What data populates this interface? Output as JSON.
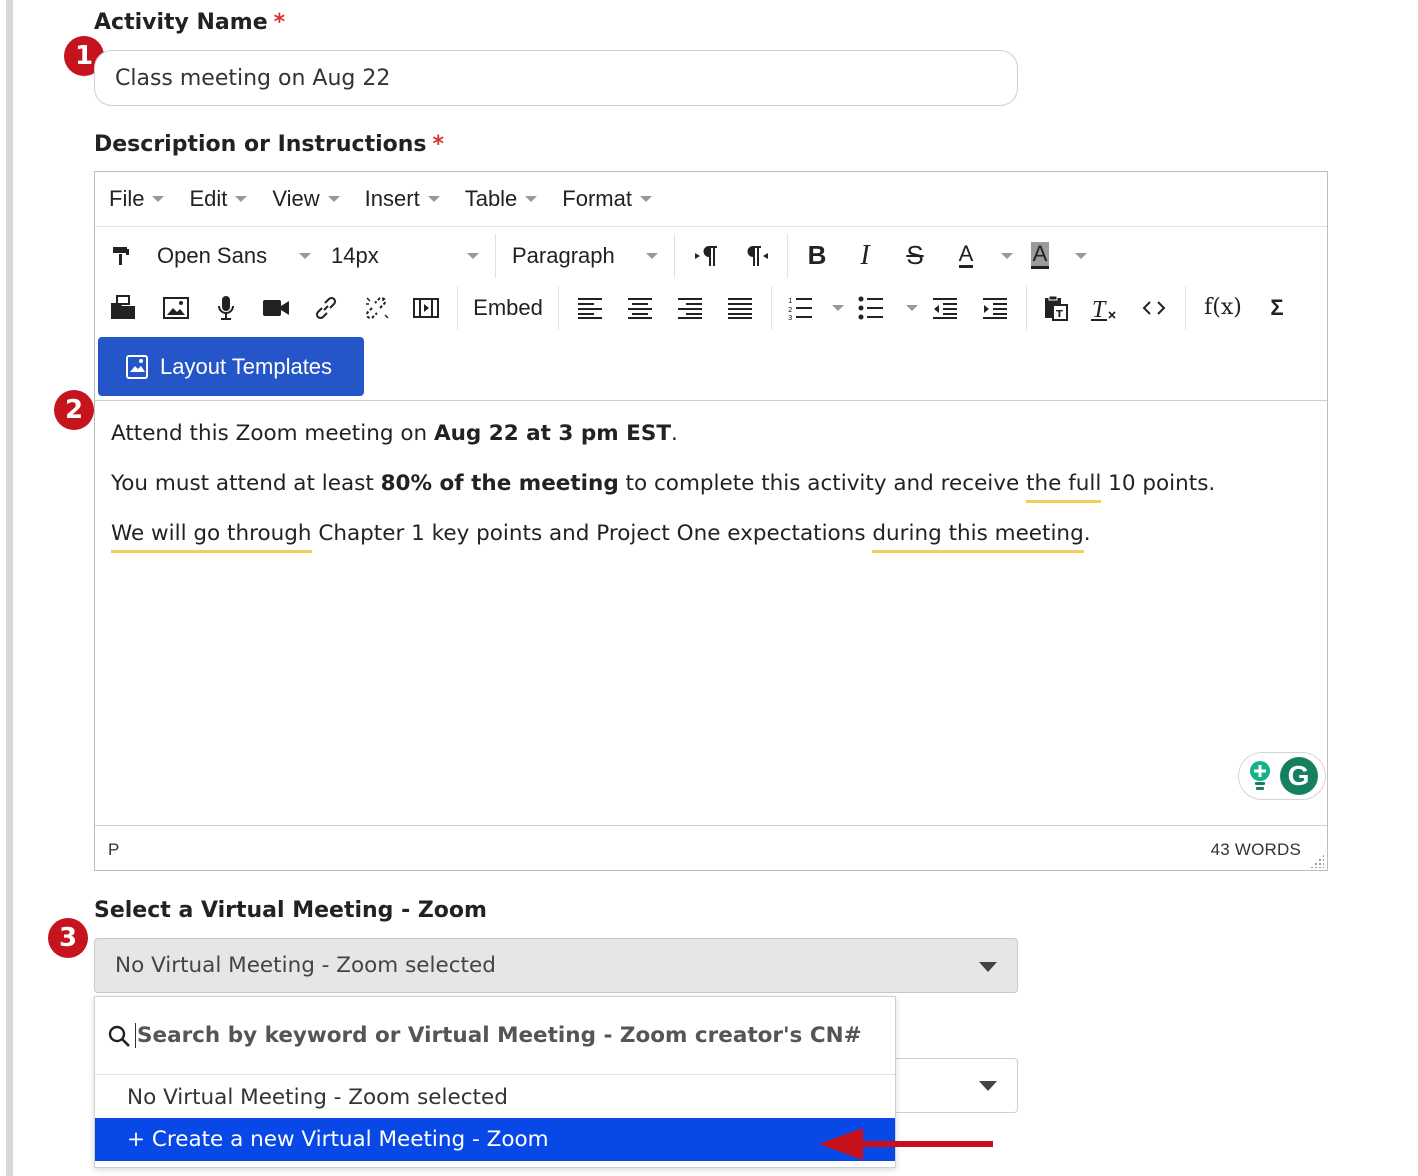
{
  "activity": {
    "label": "Activity Name",
    "required_mark": "*",
    "value": "Class meeting on Aug 22"
  },
  "steps": [
    "1",
    "2",
    "3"
  ],
  "description": {
    "label": "Description or Instructions",
    "required_mark": "*"
  },
  "editor": {
    "menus": [
      "File",
      "Edit",
      "View",
      "Insert",
      "Table",
      "Format"
    ],
    "font_family": "Open Sans",
    "font_size": "14px",
    "block_format": "Paragraph",
    "embed_label": "Embed",
    "fx_label": "f(x)",
    "sigma_label": "Σ",
    "layout_templates_label": "Layout Templates",
    "content": {
      "p1_a": "Attend this Zoom meeting on ",
      "p1_b": "Aug 22 at 3 pm EST",
      "p1_c": ".",
      "p2_a": "You must attend at least ",
      "p2_b": "80% of the meeting",
      "p2_c": " to complete this activity and receive ",
      "p2_d": "the full",
      "p2_e": " 10 points.",
      "p3_a": "We will go through",
      "p3_b": " Chapter 1 key points and Project One expectations ",
      "p3_c": "during this meeting",
      "p3_d": "."
    },
    "status_path": "P",
    "word_count": "43 WORDS",
    "grammarly_letter": "G"
  },
  "zoom": {
    "label": "Select a Virtual Meeting - Zoom",
    "selected": "No Virtual Meeting - Zoom selected",
    "search_placeholder": "Search by keyword or Virtual Meeting - Zoom creator's CN#",
    "options": [
      "No Virtual Meeting - Zoom selected",
      "+ Create a new Virtual Meeting - Zoom"
    ]
  },
  "colors": {
    "badge": "#c5141d",
    "primary_button": "#2456c9",
    "highlight": "#0748e6",
    "annotation_arrow": "#c8101c",
    "grammar_underline": "#f5cd5a"
  }
}
